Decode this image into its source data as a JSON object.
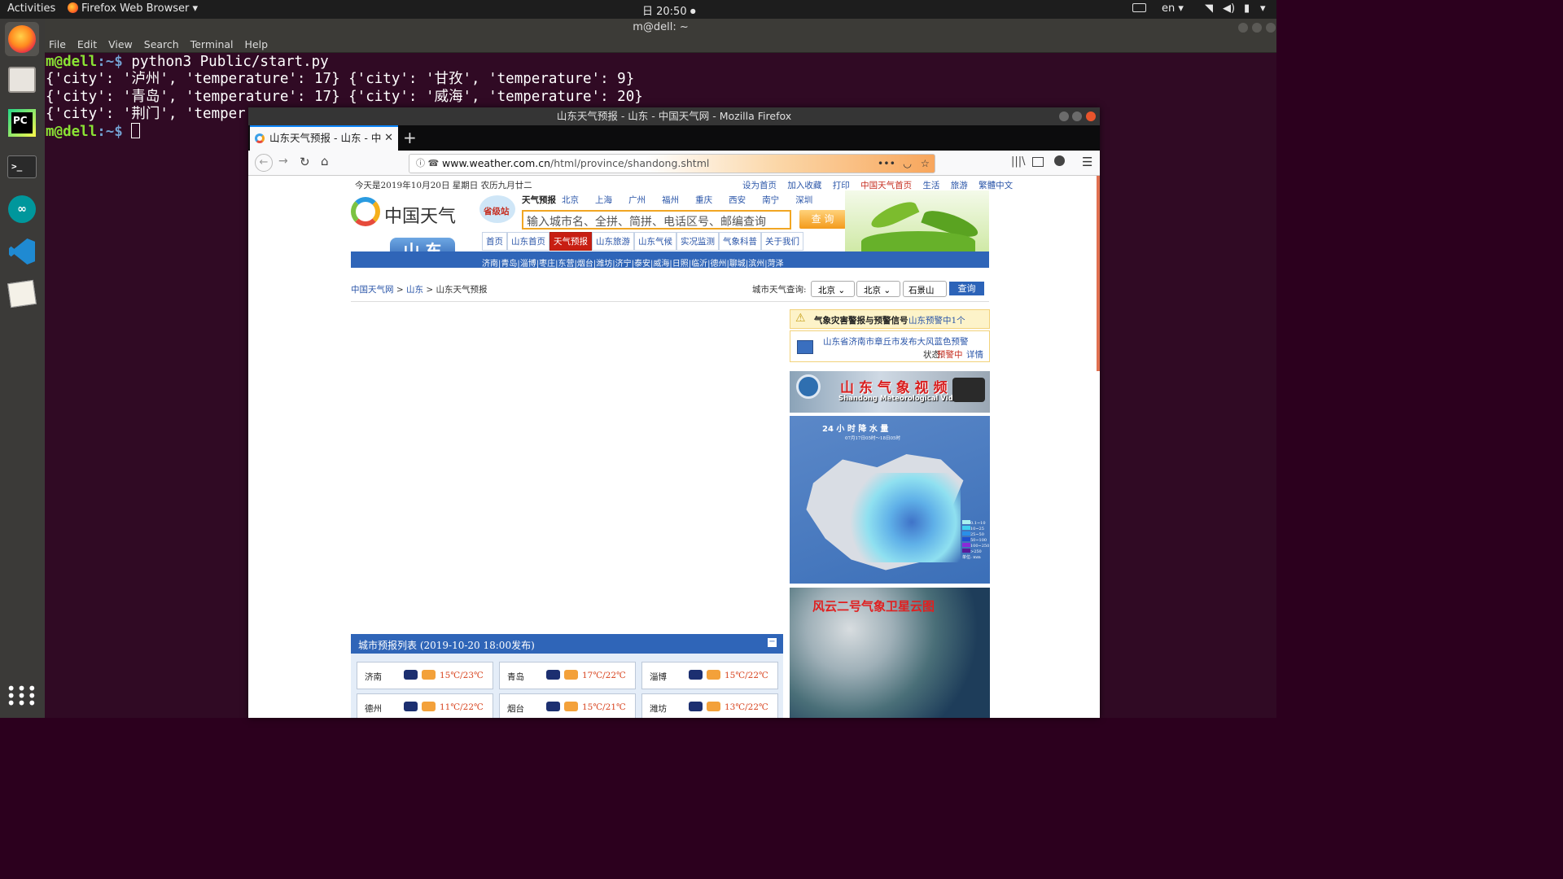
{
  "topbar": {
    "activities": "Activities",
    "app_name": "Firefox Web Browser",
    "clock": "日 20:50",
    "lang": "en"
  },
  "terminal": {
    "title": "m@dell: ~",
    "menu": [
      "File",
      "Edit",
      "View",
      "Search",
      "Terminal",
      "Help"
    ],
    "prompt_user": "m@dell",
    "prompt_path": ":~$",
    "command": " python3 Public/start.py",
    "output": [
      "{'city': '泸州', 'temperature': 17} {'city': '甘孜', 'temperature': 9}",
      "{'city': '青岛', 'temperature': 17} {'city': '威海', 'temperature': 20}",
      "{'city': '荆门', 'temper"
    ]
  },
  "firefox": {
    "window_title": "山东天气预报 - 山东 - 中国天气网 - Mozilla Firefox",
    "tab_title": "山东天气预报 - 山东 - 中国",
    "url_domain": "www.weather.com.cn",
    "url_path": "/html/province/shandong.shtml",
    "new_tab": "+"
  },
  "page": {
    "date_line": "今天是2019年10月20日   星期日   农历九月廿二",
    "top_links": [
      "设为首页",
      "加入收藏",
      "打印",
      "中国天气首页",
      "生活",
      "旅游",
      "繁體中文"
    ],
    "logo_text": "中国天气",
    "site_badge": "省级站",
    "forecast_label": "天气预报",
    "forecast_cities": [
      "北京",
      "上海",
      "广州",
      "福州",
      "重庆",
      "西安",
      "南宁",
      "深圳"
    ],
    "search_placeholder": "输入城市名、全拼、简拼、电话区号、邮编查询",
    "search_button": "查 询",
    "province": "山 东",
    "nav_tabs": [
      "首页",
      "山东首页",
      "天气预报",
      "山东旅游",
      "山东气候",
      "实况监测",
      "气象科普",
      "关于我们"
    ],
    "city_bar": [
      "济南",
      "青岛",
      "淄博",
      "枣庄",
      "东营",
      "烟台",
      "潍坊",
      "济宁",
      "泰安",
      "威海",
      "日照",
      "临沂",
      "德州",
      "聊城",
      "滨州",
      "菏泽"
    ],
    "breadcrumb": [
      "中国天气网",
      " > ",
      "山东",
      " > ",
      "山东天气预报"
    ],
    "city_query_label": "城市天气查询:",
    "selects": [
      "北京",
      "北京",
      "石景山"
    ],
    "query_button": "查询",
    "alert_title": "气象灾害警报与预警信号",
    "alert_count": "山东预警中1个",
    "alert_item": "山东省济南市章丘市发布大风蓝色预警",
    "alert_status_label": "状态:",
    "alert_status": "预警中",
    "alert_detail": "详情",
    "video_banner": "山 东 气 象 视 频",
    "video_sub": "Shandong Meteorological Video",
    "rain_map_title": "24 小 时 降 水 量",
    "rain_map_sub": "07月17日05时～18日05时",
    "rain_legend": [
      "0.1~10",
      "10~25",
      "25~50",
      "50~100",
      "100~250",
      ">250"
    ],
    "rain_unit": "单位: mm",
    "satellite_title": "风云二号气象卫星云图",
    "forecast_list_title": "城市预报列表 (2019-10-20 18:00发布)",
    "forecast_cards": [
      {
        "city": "济南",
        "temp": "15℃/23℃"
      },
      {
        "city": "青岛",
        "temp": "17℃/22℃"
      },
      {
        "city": "淄博",
        "temp": "15℃/22℃"
      },
      {
        "city": "德州",
        "temp": "11℃/22℃"
      },
      {
        "city": "烟台",
        "temp": "15℃/21℃"
      },
      {
        "city": "潍坊",
        "temp": "13℃/22℃"
      }
    ]
  }
}
